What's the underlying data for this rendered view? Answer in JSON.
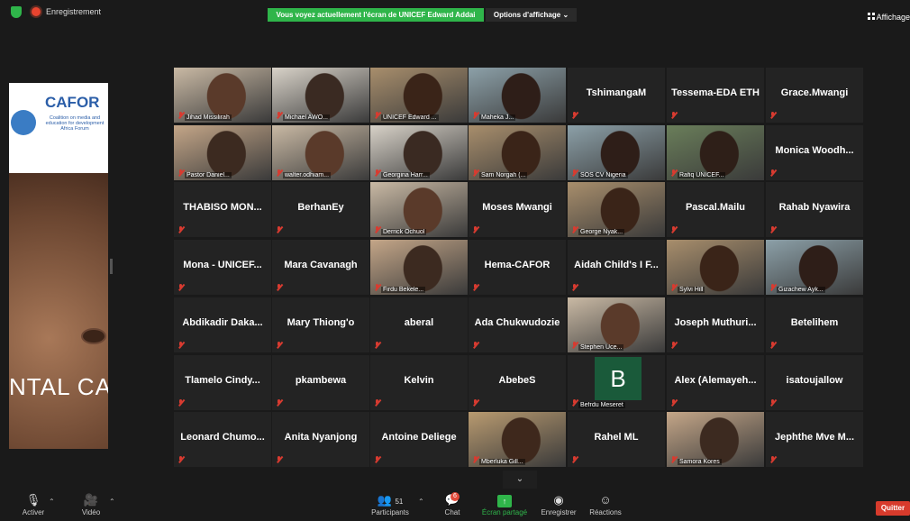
{
  "topbar": {
    "recording_label": "Enregistrement",
    "share_banner": "Vous voyez actuellement l'écran de UNICEF Edward Addai",
    "view_options_label": "Options d'affichage",
    "view_options_caret": "⌄",
    "view_button_label": "Affichage"
  },
  "shared_screen": {
    "logo_title": "CAFOR",
    "logo_subtitle": "Coalition on media and education for development Africa Forum",
    "slide_text": "NTAL CA"
  },
  "participants": [
    {
      "name": "Jihad Missilirah",
      "video": true
    },
    {
      "name": "Michael AWO...",
      "video": true
    },
    {
      "name": "UNICEF Edward ...",
      "video": true,
      "highlighted": true
    },
    {
      "name": "Maheka J...",
      "video": true
    },
    {
      "name": "TshimangaM",
      "video": false
    },
    {
      "name": "Tessema-EDA ETH",
      "video": false
    },
    {
      "name": "Grace.Mwangi",
      "video": false
    },
    {
      "name": "Pastor Daniel...",
      "video": true
    },
    {
      "name": "walter.odhiam...",
      "video": true
    },
    {
      "name": "Georgina Harr...",
      "video": true
    },
    {
      "name": "Sam Norgah (...",
      "video": true
    },
    {
      "name": "SOS CV Nigeria",
      "video": true
    },
    {
      "name": "Rafiq UNICEF...",
      "video": true
    },
    {
      "name": "Monica Woodh...",
      "video": false
    },
    {
      "name": "THABISO MON...",
      "video": false
    },
    {
      "name": "BerhanEy",
      "video": false
    },
    {
      "name": "Derrick Ochuol",
      "video": true
    },
    {
      "name": "Moses Mwangi",
      "video": false
    },
    {
      "name": "George Nyak...",
      "video": true
    },
    {
      "name": "Pascal.Mailu",
      "video": false
    },
    {
      "name": "Rahab Nyawira",
      "video": false
    },
    {
      "name": "Mona - UNICEF...",
      "video": false
    },
    {
      "name": "Mara Cavanagh",
      "video": false
    },
    {
      "name": "Firdu Bekele...",
      "video": true
    },
    {
      "name": "Hema-CAFOR",
      "video": false
    },
    {
      "name": "Aidah Child's I F...",
      "video": false
    },
    {
      "name": "Sylvi Hill",
      "video": true
    },
    {
      "name": "Gizachew Ayk...",
      "video": true
    },
    {
      "name": "Abdikadir Daka...",
      "video": false
    },
    {
      "name": "Mary Thiong'o",
      "video": false
    },
    {
      "name": "aberal",
      "video": false
    },
    {
      "name": "Ada Chukwudozie",
      "video": false
    },
    {
      "name": "Stephen Uce...",
      "video": true
    },
    {
      "name": "Joseph Muthuri...",
      "video": false
    },
    {
      "name": "Betelihem",
      "video": false
    },
    {
      "name": "Tlamelo Cindy...",
      "video": false
    },
    {
      "name": "pkambewa",
      "video": false
    },
    {
      "name": "Kelvin",
      "video": false
    },
    {
      "name": "AbebeS",
      "video": false
    },
    {
      "name": "Befrdu Meseret",
      "video": true,
      "initial": "B"
    },
    {
      "name": "Alex (Alemayeh...",
      "video": false
    },
    {
      "name": "isatoujallow",
      "video": false
    },
    {
      "name": "Leonard Chumo...",
      "video": false
    },
    {
      "name": "Anita Nyanjong",
      "video": false
    },
    {
      "name": "Antoine Deliege",
      "video": false
    },
    {
      "name": "Mberluka Gill...",
      "video": true
    },
    {
      "name": "Rahel ML",
      "video": false
    },
    {
      "name": "Samora Kores",
      "video": true
    },
    {
      "name": "Jephthe Mve M...",
      "video": false
    }
  ],
  "toolbar": {
    "mute_label": "Activer",
    "video_label": "Vidéo",
    "participants_label": "Participants",
    "participants_count": "51",
    "chat_label": "Chat",
    "chat_badge": "6",
    "share_label": "Écran partagé",
    "record_label": "Enregistrer",
    "reactions_label": "Réactions",
    "quit_label": "Quitter"
  },
  "colors": {
    "share_green": "#2fb54a",
    "tile_bg": "#232323",
    "mute_red": "#d83b30",
    "quit_red": "#d73b2c",
    "active_speaker": "#b5e06a"
  }
}
